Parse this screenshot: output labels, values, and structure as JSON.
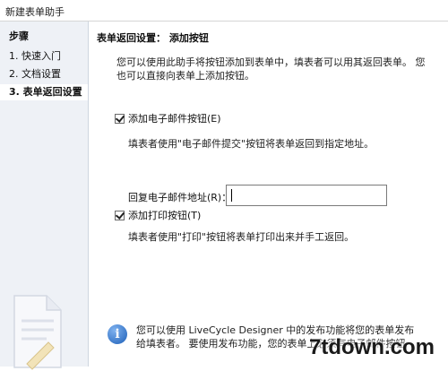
{
  "window": {
    "title": "新建表单助手"
  },
  "sidebar": {
    "heading": "步骤",
    "steps": [
      {
        "label": "1. 快速入门",
        "active": false
      },
      {
        "label": "2. 文档设置",
        "active": false
      },
      {
        "label": "3. 表单返回设置",
        "active": true
      }
    ]
  },
  "main": {
    "section_title": "表单返回设置： 添加按钮",
    "description": "您可以使用此助手将按钮添加到表单中，填表者可以用其返回表单。 您也可以直接向表单上添加按钮。",
    "email_option": {
      "label": "添加电子邮件按钮(E)",
      "checked": true,
      "hint": "填表者使用\"电子邮件提交\"按钮将表单返回到指定地址。",
      "address_label": "回复电子邮件地址(R)：",
      "address_value": ""
    },
    "print_option": {
      "label": "添加打印按钮(T)",
      "checked": true,
      "hint": "填表者使用\"打印\"按钮将表单打印出来并手工返回。"
    },
    "footer_info": "您可以使用 LiveCycle Designer 中的发布功能将您的表单发布给填表者。 要使用发布功能，您的表单上必须有电子邮件按钮"
  },
  "watermark": {
    "text": "7tdown.com"
  },
  "icons": {
    "info": "info-icon",
    "document": "document-icon"
  }
}
